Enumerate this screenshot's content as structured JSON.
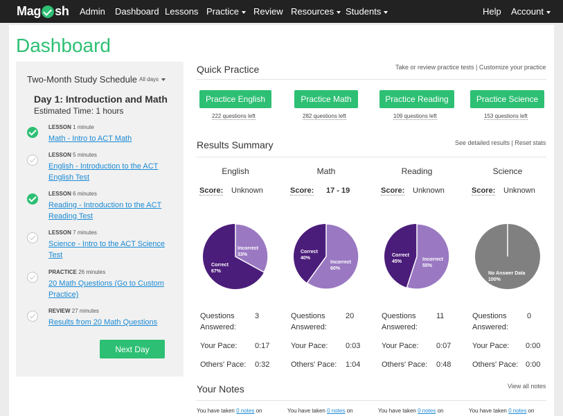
{
  "nav": {
    "logo_left": "Mag",
    "logo_right": "sh",
    "items": [
      "Admin",
      "Dashboard",
      "Lessons",
      "Practice",
      "Review",
      "Resources",
      "Students"
    ],
    "right_items": [
      "Help",
      "Account"
    ]
  },
  "page_title": "Dashboard",
  "sidebar": {
    "title": "Two-Month Study Schedule",
    "filter": "All days",
    "day_title": "Day 1: Introduction and Math",
    "est_time": "Estimated Time: 1 hours",
    "items": [
      {
        "type": "LESSON",
        "duration": "1 minute",
        "title": "Math - Intro to ACT Math",
        "done": true
      },
      {
        "type": "LESSON",
        "duration": "5 minutes",
        "title": "English - Introduction to the ACT English Test",
        "done": false
      },
      {
        "type": "LESSON",
        "duration": "6 minutes",
        "title": "Reading - Introduction to the ACT Reading Test",
        "done": true
      },
      {
        "type": "LESSON",
        "duration": "7 minutes",
        "title": "Science - Intro to the ACT Science Test",
        "done": false
      },
      {
        "type": "PRACTICE",
        "duration": "26 minutes",
        "title": "20 Math Questions (Go to Custom Practice)",
        "done": false
      },
      {
        "type": "REVIEW",
        "duration": "27 minutes",
        "title": "Results from 20 Math Questions",
        "done": false
      }
    ],
    "next_day": "Next Day"
  },
  "quick_practice": {
    "title": "Quick Practice",
    "links": "Take or review practice tests | Customize your practice",
    "buttons": [
      {
        "label": "Practice English",
        "left": "222 questions left"
      },
      {
        "label": "Practice Math",
        "left": "282 questions left"
      },
      {
        "label": "Practice Reading",
        "left": "109 questions left"
      },
      {
        "label": "Practice Science",
        "left": "153 questions left"
      }
    ]
  },
  "results": {
    "title": "Results Summary",
    "links": "See detailed results | Reset stats",
    "score_label": "Score:",
    "stat_labels": {
      "answered": "Questions Answered:",
      "pace": "Your Pace:",
      "others": "Others' Pace:"
    },
    "subjects": [
      {
        "name": "English",
        "score": "Unknown",
        "correct": 67,
        "incorrect": 33,
        "correct_label": "Correct",
        "correct_pct": "67%",
        "incorrect_label": "Incorrect",
        "incorrect_pct": "33%",
        "answered": "3",
        "pace": "0:17",
        "others": "0:32"
      },
      {
        "name": "Math",
        "score": "17 - 19",
        "correct": 40,
        "incorrect": 60,
        "correct_label": "Correct",
        "correct_pct": "40%",
        "incorrect_label": "Incorrect",
        "incorrect_pct": "60%",
        "answered": "20",
        "pace": "0:03",
        "others": "1:04"
      },
      {
        "name": "Reading",
        "score": "Unknown",
        "correct": 45,
        "incorrect": 55,
        "correct_label": "Correct",
        "correct_pct": "45%",
        "incorrect_label": "Incorrect",
        "incorrect_pct": "55%",
        "answered": "11",
        "pace": "0:07",
        "others": "0:48"
      },
      {
        "name": "Science",
        "score": "Unknown",
        "no_data": true,
        "no_data_label": "No Answer Data",
        "no_data_pct": "100%",
        "answered": "0",
        "pace": "0:00",
        "others": "0:00"
      }
    ]
  },
  "notes": {
    "title": "Your Notes",
    "link": "View all notes",
    "prefix": "You have taken",
    "link_text": "0 notes",
    "suffix": "on"
  },
  "colors": {
    "green": "#2dbf73",
    "dark_purple": "#4b1d7a",
    "light_purple": "#9a78c2",
    "gray": "#808080",
    "link": "#1a8ad4"
  }
}
